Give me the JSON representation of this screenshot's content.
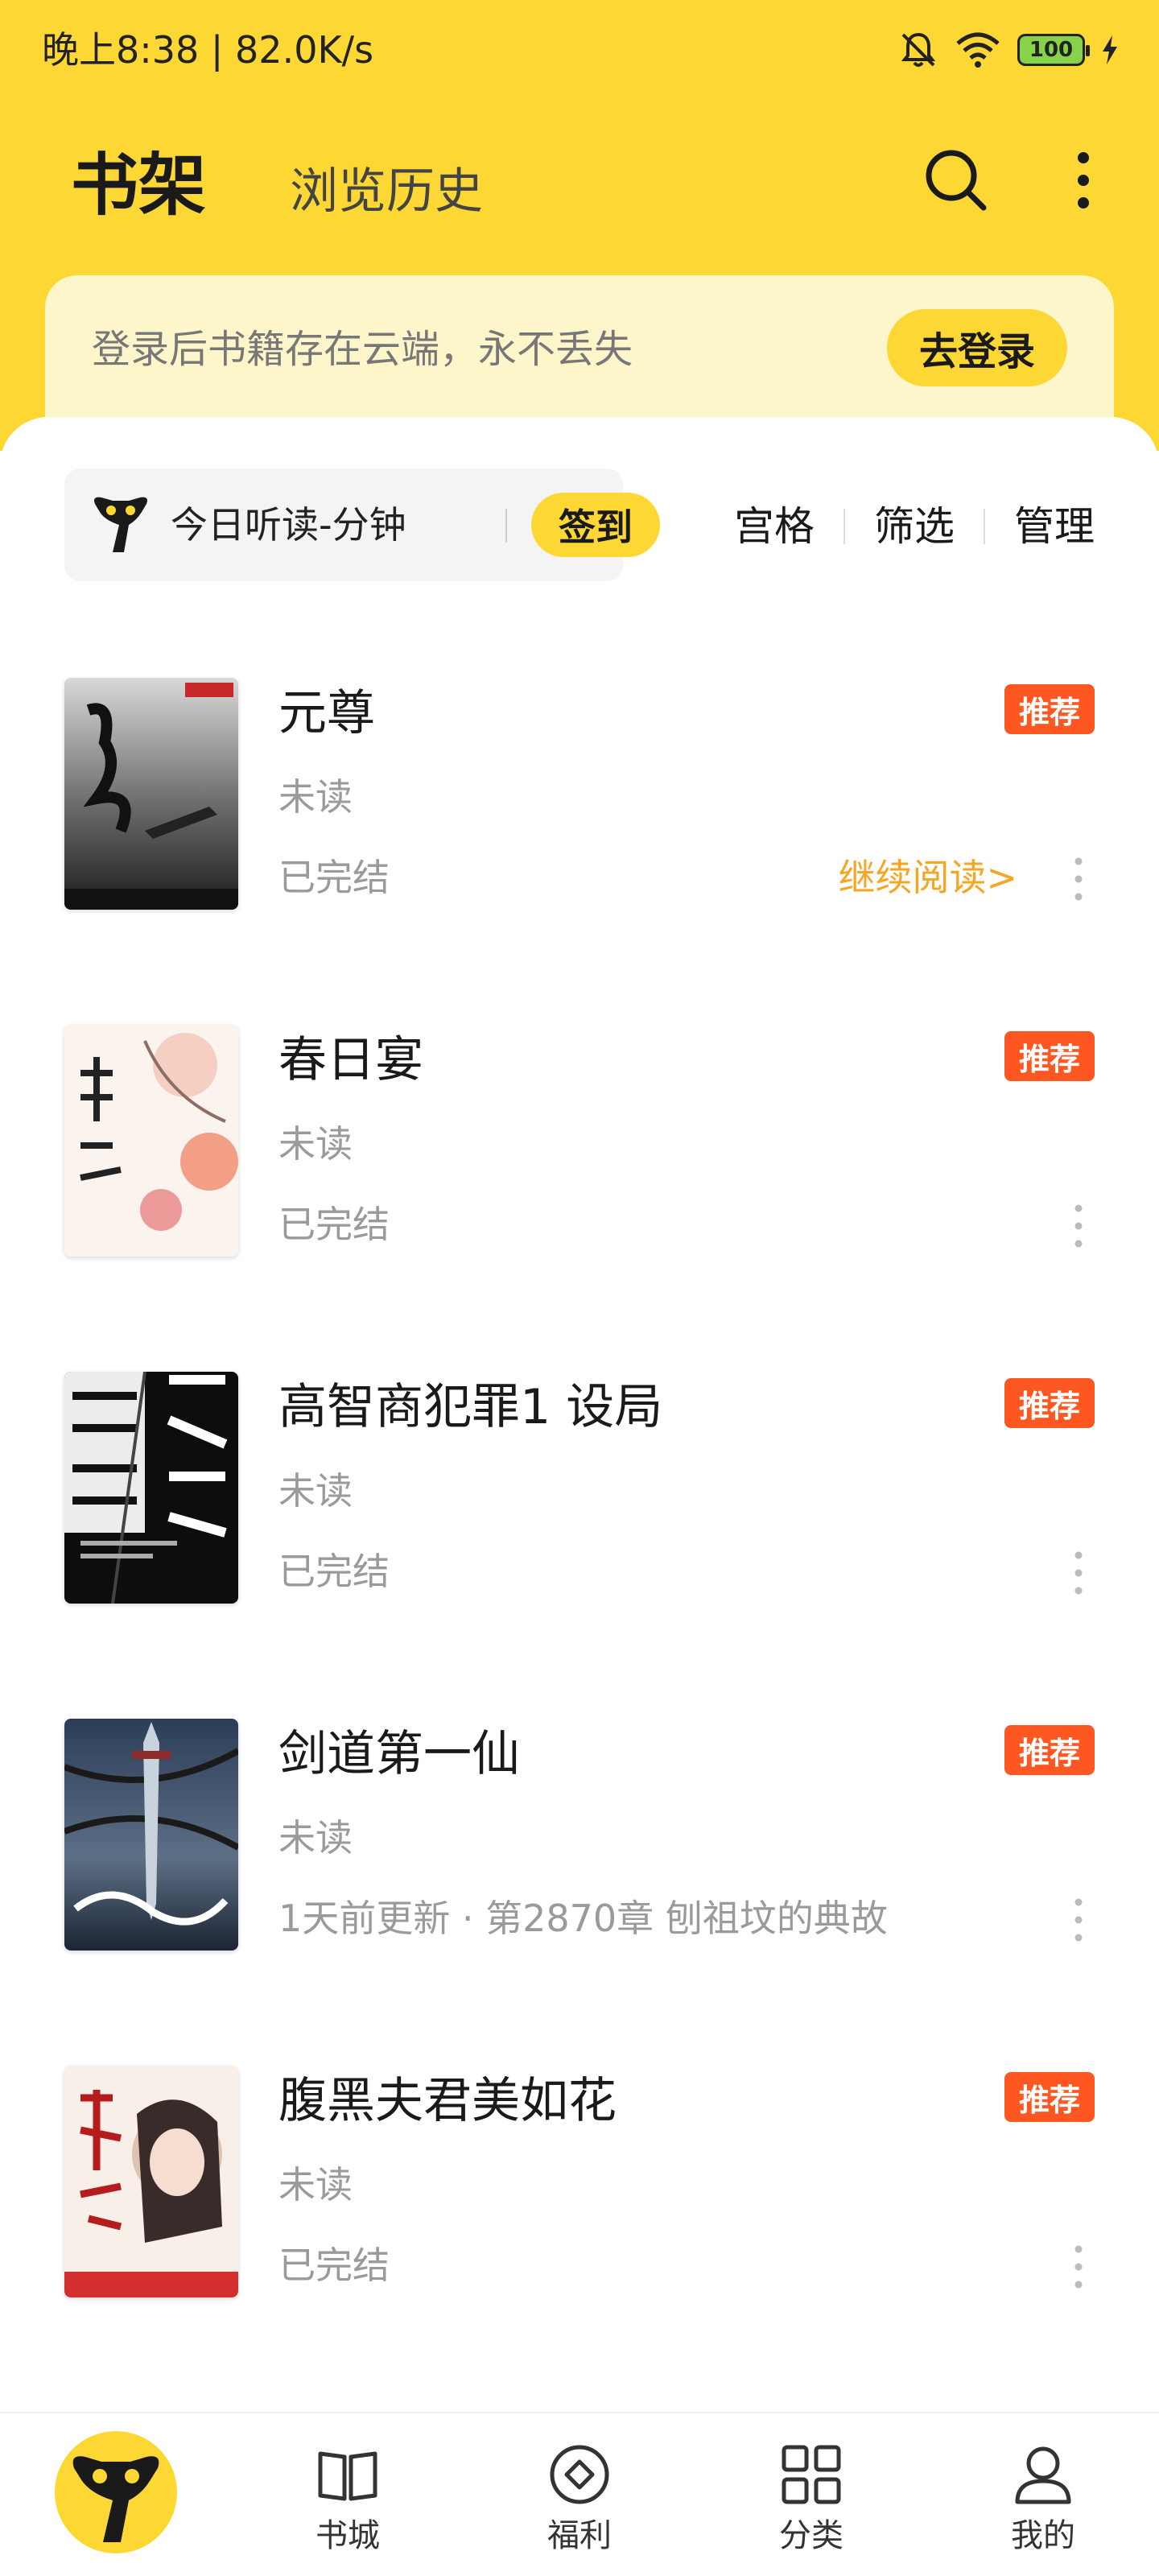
{
  "status_bar": {
    "left_text": "晚上8:38 | 82.0K/s",
    "battery": "100"
  },
  "header": {
    "active_tab": "书架",
    "tab_history": "浏览历史"
  },
  "login_banner": {
    "text": "登录后书籍存在云端，永不丢失",
    "button": "去登录"
  },
  "listen": {
    "text": "今日听读-分钟",
    "checkin": "签到"
  },
  "toolbar": {
    "grid": "宫格",
    "filter": "筛选",
    "manage": "管理"
  },
  "colors": {
    "brand_yellow": "#FDD835",
    "badge_orange": "#FF5722",
    "continue_orange": "#F5A623"
  },
  "books": [
    {
      "title": "元尊",
      "read": "未读",
      "status": "已完结",
      "badge": "推荐",
      "continue": "继续阅读>"
    },
    {
      "title": "春日宴",
      "read": "未读",
      "status": "已完结",
      "badge": "推荐",
      "continue": ""
    },
    {
      "title": "高智商犯罪1 设局",
      "read": "未读",
      "status": "已完结",
      "badge": "推荐",
      "continue": ""
    },
    {
      "title": "剑道第一仙",
      "read": "未读",
      "status": "1天前更新 · 第2870章 刨祖坟的典故",
      "badge": "推荐",
      "continue": ""
    },
    {
      "title": "腹黑夫君美如花",
      "read": "未读",
      "status": "已完结",
      "badge": "推荐",
      "continue": ""
    }
  ],
  "bottom_nav": {
    "items": [
      {
        "label": "",
        "icon": "app-logo-icon"
      },
      {
        "label": "书城",
        "icon": "book-icon"
      },
      {
        "label": "福利",
        "icon": "coin-icon"
      },
      {
        "label": "分类",
        "icon": "grid-icon"
      },
      {
        "label": "我的",
        "icon": "user-icon"
      }
    ]
  }
}
